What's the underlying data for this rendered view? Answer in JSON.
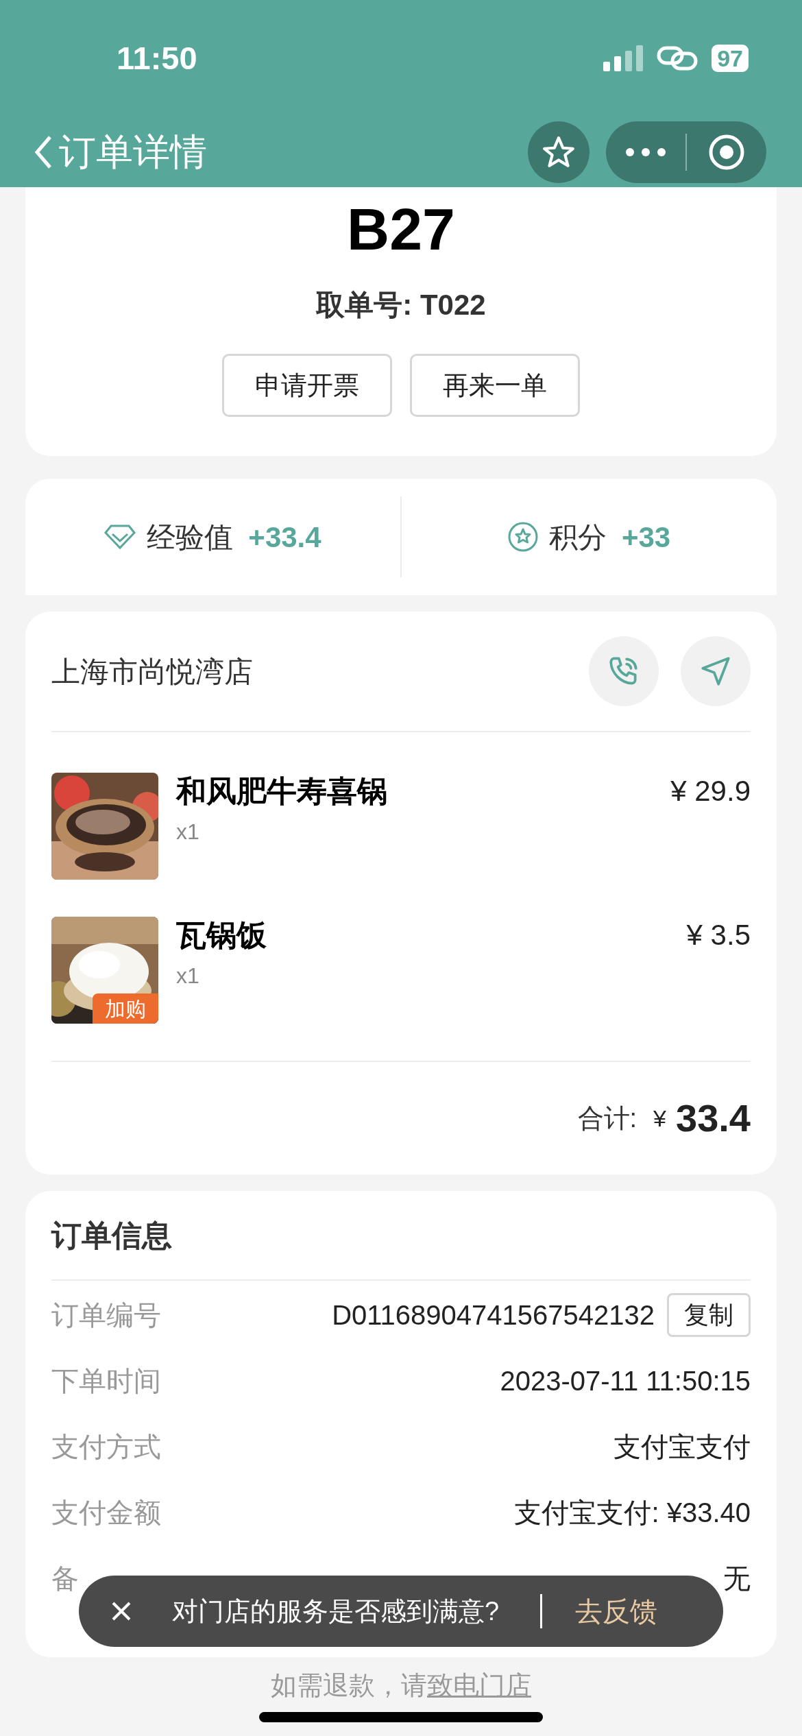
{
  "status_bar": {
    "time": "11:50",
    "battery": "97"
  },
  "nav": {
    "title": "订单详情"
  },
  "pickup": {
    "code": "B27",
    "order_label": "取单号: T022",
    "buttons": [
      "申请开票",
      "再来一单"
    ]
  },
  "rewards": [
    {
      "kind": "diamond",
      "label": "经验值",
      "value": "+33.4"
    },
    {
      "kind": "star",
      "label": "积分",
      "value": "+33"
    }
  ],
  "store": {
    "name": "上海市尚悦湾店",
    "items": [
      {
        "kind": "stew",
        "name": "和风肥牛寿喜锅",
        "qty": "x1",
        "price": "¥ 29.9"
      },
      {
        "kind": "rice",
        "name": "瓦锅饭",
        "qty": "x1",
        "price": "¥ 3.5",
        "badge": "加购"
      }
    ],
    "total_label": "合计:",
    "total_currency": "¥",
    "total": "33.4"
  },
  "order_info": {
    "title": "订单信息",
    "rows": [
      {
        "label": "订单编号",
        "value": "D01168904741567542132",
        "action": "复制"
      },
      {
        "label": "下单时间",
        "value": "2023-07-11 11:50:15"
      },
      {
        "label": "支付方式",
        "value": "支付宝支付"
      },
      {
        "label": "支付金额",
        "value": "支付宝支付: ¥33.40"
      },
      {
        "label": "备",
        "value": "无"
      }
    ]
  },
  "toast": {
    "text": "对门店的服务是否感到满意?",
    "action": "去反馈"
  },
  "refund": {
    "text": "如需退款，请",
    "link": "致电门店"
  }
}
